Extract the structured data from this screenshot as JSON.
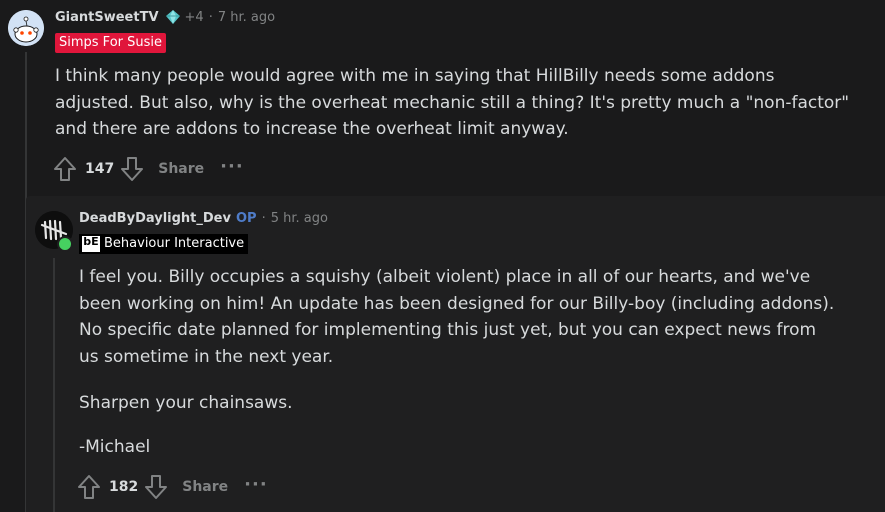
{
  "comment": {
    "username": "GiantSweetTV",
    "karma_badge": "+4",
    "separator": "·",
    "time": "7 hr. ago",
    "flair": "Simps For Susie",
    "body": [
      "I think many people would agree with me in saying that HillBilly needs some addons adjusted. But also, why is the overheat mechanic still a thing? It's pretty much a \"non-factor\" and there are addons to increase the overheat limit anyway."
    ],
    "votes": "147",
    "share_label": "Share",
    "more_label": "···"
  },
  "reply": {
    "username": "DeadByDaylight_Dev",
    "op_label": "OP",
    "separator": "·",
    "time": "5 hr. ago",
    "flair": "Behaviour Interactive",
    "flair_logo": "bE",
    "body": [
      "I feel you. Billy occupies a squishy (albeit violent) place in all of our hearts, and we've been working on him! An update has been designed for our Billy-boy (including addons). No specific date planned for implementing this just yet,  but you can expect news from us sometime in the next year.",
      "Sharpen your chainsaws.",
      "-Michael"
    ],
    "votes": "182",
    "share_label": "Share",
    "more_label": "···"
  },
  "icons": {
    "avatar_1": "reddit-snoo-avatar",
    "avatar_2": "dbd-avatar",
    "upvote": "upvote-arrow-icon",
    "downvote": "downvote-arrow-icon",
    "more": "ellipsis-icon",
    "gem": "diamond-gem-icon"
  },
  "colors": {
    "background": "#1a1a1b",
    "reply_background": "#1f1f20",
    "text": "#d7dadc",
    "meta": "#818384",
    "flair_red": "#e0163b",
    "op_blue": "#4f7cc8",
    "online_green": "#46d160"
  }
}
